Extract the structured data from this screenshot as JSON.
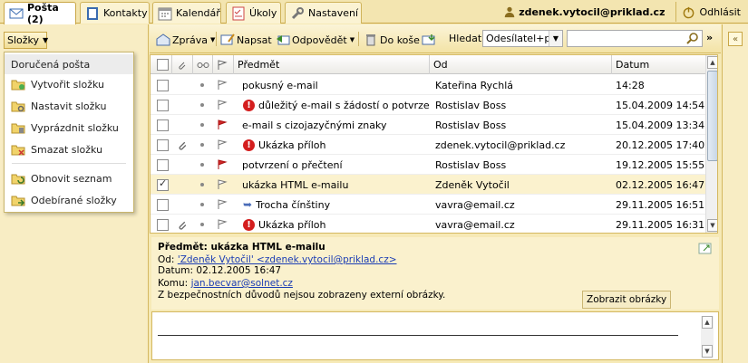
{
  "tabs": [
    {
      "label": "Pošta (2)",
      "icon": "mail-icon",
      "active": true
    },
    {
      "label": "Kontakty",
      "icon": "address-book-icon",
      "active": false
    },
    {
      "label": "Kalendář",
      "icon": "calendar-icon",
      "active": false
    },
    {
      "label": "Úkoly",
      "icon": "tasks-icon",
      "active": false
    },
    {
      "label": "Nastavení",
      "icon": "settings-wrench-icon",
      "active": false
    }
  ],
  "user": {
    "email": "zdenek.vytocil@priklad.cz",
    "logout_label": "Odhlásit"
  },
  "sidebar": {
    "folders_button": "Složky",
    "menu": [
      {
        "label": "Doručená pošta",
        "icon": ""
      },
      {
        "label": "Vytvořit složku",
        "icon": "folder-new-icon"
      },
      {
        "label": "Nastavit složku",
        "icon": "folder-settings-icon"
      },
      {
        "label": "Vyprázdnit složku",
        "icon": "folder-empty-icon"
      },
      {
        "label": "Smazat složku",
        "icon": "folder-delete-icon"
      },
      {
        "label": "Obnovit seznam",
        "icon": "refresh-icon"
      },
      {
        "label": "Odebírané složky",
        "icon": "folder-subscribe-icon"
      }
    ]
  },
  "toolbar": {
    "message": "Zpráva",
    "compose": "Napsat",
    "reply": "Odpovědět",
    "to_trash": "Do koše",
    "search_label": "Hledat:",
    "search_field": "Odesílatel+př",
    "search_value": "",
    "collapse": "»"
  },
  "list": {
    "headers": {
      "subject": "Předmět",
      "from": "Od",
      "date": "Datum"
    },
    "rows": [
      {
        "subject": "pokusný e-mail",
        "from": "Kateřina Rychlá",
        "date": "14:28",
        "important": false,
        "reply": false,
        "flag": "white",
        "attach": false,
        "checked": false
      },
      {
        "subject": "důležitý e-mail s žádostí o potvrzení př",
        "from": "Rostislav Boss",
        "date": "15.04.2009 14:54",
        "important": true,
        "reply": false,
        "flag": "white",
        "attach": false,
        "checked": false
      },
      {
        "subject": "e-mail s cizojazyčnými znaky",
        "from": "Rostislav Boss",
        "date": "15.04.2009 13:34",
        "important": false,
        "reply": false,
        "flag": "red",
        "attach": false,
        "checked": false
      },
      {
        "subject": "Ukázka příloh",
        "from": "zdenek.vytocil@priklad.cz",
        "date": "20.12.2005 17:40",
        "important": true,
        "reply": false,
        "flag": "white",
        "attach": true,
        "checked": false
      },
      {
        "subject": "potvrzení o přečtení",
        "from": "Rostislav Boss",
        "date": "19.12.2005 15:55",
        "important": false,
        "reply": false,
        "flag": "red",
        "attach": false,
        "checked": false
      },
      {
        "subject": "ukázka HTML e-mailu",
        "from": "Zdeněk Vytočil",
        "date": "02.12.2005 16:47",
        "important": false,
        "reply": false,
        "flag": "white",
        "attach": false,
        "checked": true
      },
      {
        "subject": "Trocha čínštiny",
        "from": "vavra@email.cz",
        "date": "29.11.2005 16:51",
        "important": false,
        "reply": true,
        "flag": "white",
        "attach": false,
        "checked": false
      },
      {
        "subject": "Ukázka příloh",
        "from": "vavra@email.cz",
        "date": "29.11.2005 16:31",
        "important": true,
        "reply": false,
        "flag": "white",
        "attach": true,
        "checked": false
      }
    ]
  },
  "preview": {
    "subject_line": "Předmět: ukázka HTML e-mailu",
    "from_label": "Od:",
    "from_value": "'Zdeněk Vytočil' <zdenek.vytocil@priklad.cz>",
    "date_line": "Datum: 02.12.2005 16:47",
    "to_label": "Komu:",
    "to_value": "jan.becvar@solnet.cz",
    "notice": "Z bezpečnostních důvodů nejsou zobrazeny externí obrázky.",
    "show_images": "Zobrazit obrázky"
  },
  "right_panel": {
    "expand": "«"
  }
}
